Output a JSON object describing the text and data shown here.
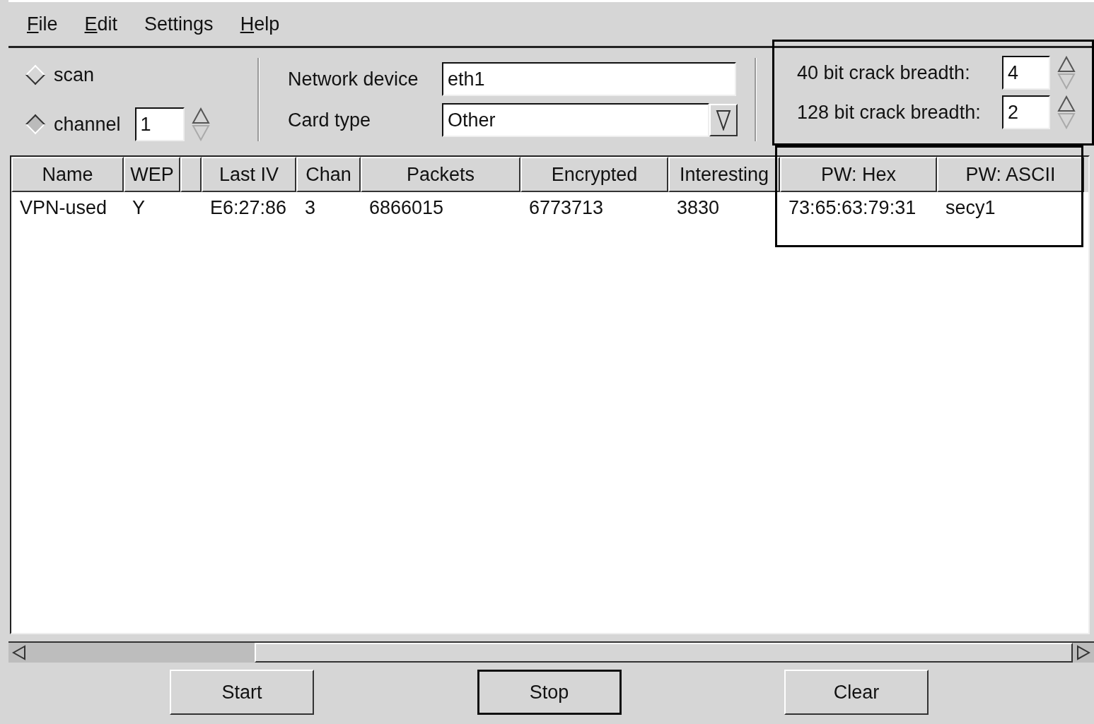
{
  "menu": [
    {
      "label": "File",
      "mnemonic": true
    },
    {
      "label": "Edit",
      "mnemonic": true
    },
    {
      "label": "Settings",
      "mnemonic": false
    },
    {
      "label": "Help",
      "mnemonic": true
    }
  ],
  "mode": [
    {
      "label": "scan",
      "selected": false
    },
    {
      "label": "channel",
      "selected": true,
      "value": "1"
    }
  ],
  "device": {
    "label": "Network device",
    "value": "eth1"
  },
  "card": {
    "label": "Card type",
    "value": "Other"
  },
  "crack": [
    {
      "label": "40 bit crack breadth:",
      "value": "4"
    },
    {
      "label": "128 bit crack breadth:",
      "value": "2"
    }
  ],
  "table": {
    "columns": [
      "Name",
      "WEP",
      "",
      "Last IV",
      "Chan",
      "Packets",
      "Encrypted",
      "Interesting",
      "PW: Hex",
      "PW: ASCII"
    ],
    "rows": [
      [
        "VPN-used",
        "Y",
        "",
        "E6:27:86",
        "3",
        "6866015",
        "6773713",
        "3830",
        "73:65:63:79:31",
        "secy1"
      ]
    ]
  },
  "buttons": [
    {
      "label": "Start",
      "selected": false
    },
    {
      "label": "Stop",
      "selected": true
    },
    {
      "label": "Clear",
      "selected": false
    }
  ]
}
